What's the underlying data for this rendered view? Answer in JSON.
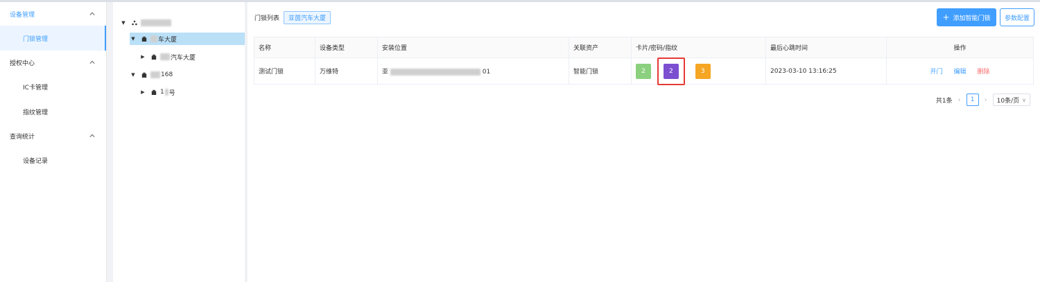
{
  "sidebar": {
    "groups": [
      {
        "label": "设备管理",
        "items": [
          {
            "label": "门锁管理"
          }
        ]
      },
      {
        "label": "授权中心",
        "items": [
          {
            "label": "IC卡管理"
          },
          {
            "label": "指纹管理"
          }
        ]
      },
      {
        "label": "查询统计",
        "items": [
          {
            "label": "设备记录"
          }
        ]
      }
    ]
  },
  "tree": {
    "building1_suffix": "车大厦",
    "building1_child_suffix": "汽车大厦",
    "building2_suffix": "168",
    "building2_child_suffix": "号",
    "building2_child_prefix": "1"
  },
  "main": {
    "crumb_label": "门锁列表",
    "crumb_tag": "亚茵汽车大厦",
    "add_button": "添加智能门锁",
    "config_button": "参数配置",
    "columns": [
      "名称",
      "设备类型",
      "安装位置",
      "关联资产",
      "卡片/密码/指纹",
      "最后心跳时间",
      "操作"
    ],
    "rows": [
      {
        "name": "测试门锁",
        "type": "万维特",
        "location_prefix": "亚",
        "location_suffix": "01",
        "asset": "智能门锁",
        "card_count": "2",
        "password_count": "2",
        "fingerprint_count": "3",
        "last_heartbeat": "2023-03-10 13:16:25",
        "actions": {
          "open": "开门",
          "edit": "编辑",
          "delete": "删除"
        }
      }
    ]
  },
  "pager": {
    "total": "共1条",
    "current_page": "1",
    "page_size": "10条/页"
  },
  "colors": {
    "primary": "#409eff",
    "danger": "#f56c6c",
    "card_badge": "#8bd07f",
    "password_badge": "#7c4fd1",
    "fingerprint_badge": "#f5a623",
    "highlight": "#e53935"
  }
}
